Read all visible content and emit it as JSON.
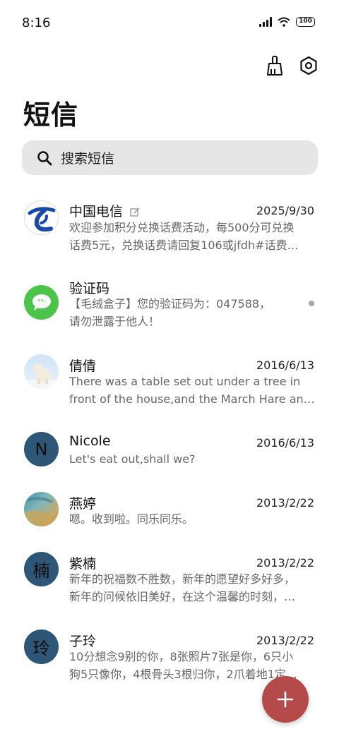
{
  "status_bar": {
    "time": "8:16",
    "battery": "100"
  },
  "toolbar": {
    "clean_icon": "broom-icon",
    "settings_icon": "hexagon-settings-icon"
  },
  "title": "短信",
  "search": {
    "placeholder": "搜索短信"
  },
  "conversations": [
    {
      "name": "中国电信",
      "date": "2025/9/30",
      "line1": "欢迎参加积分兑换话费活动，每500分可兑换",
      "line2": "话费5元，兑换话费请回复106或jfdh#话费…"
    },
    {
      "name": "验证码",
      "date": "",
      "line1": "【毛绒盒子】您的验证码为：047588，",
      "line2": "请勿泄露于他人！"
    },
    {
      "name": "倩倩",
      "date": "2016/6/13",
      "line1": "There was a table set out under a tree in",
      "line2": "front of the house,and the March Hare an…"
    },
    {
      "name": "Nicole",
      "date": "2016/6/13",
      "avatar_letter": "N",
      "line1": "Let's eat out,shall we?",
      "line2": ""
    },
    {
      "name": "燕婷",
      "date": "2013/2/22",
      "line1": "嗯。收到啦。同乐同乐。",
      "line2": ""
    },
    {
      "name": "紫楠",
      "date": "2013/2/22",
      "avatar_letter": "楠",
      "line1": "新年的祝福数不胜数，新年的愿望好多好多，",
      "line2": "新年的问候依旧美好，在这个温馨的时刻，…"
    },
    {
      "name": "子玲",
      "date": "2013/2/22",
      "avatar_letter": "玲",
      "line1": "10分想念9别的你，8张照片7张是你，6只小",
      "line2": "狗5只像你，4根骨头3根归你，2爪着地1定…"
    }
  ],
  "colors": {
    "accent_fab": "#b44a4a",
    "avatar_blue": "#2e5677",
    "search_bg": "#e6e6e6",
    "sms_green": "#4cc34a",
    "telecom_blue": "#1a4aa8"
  }
}
